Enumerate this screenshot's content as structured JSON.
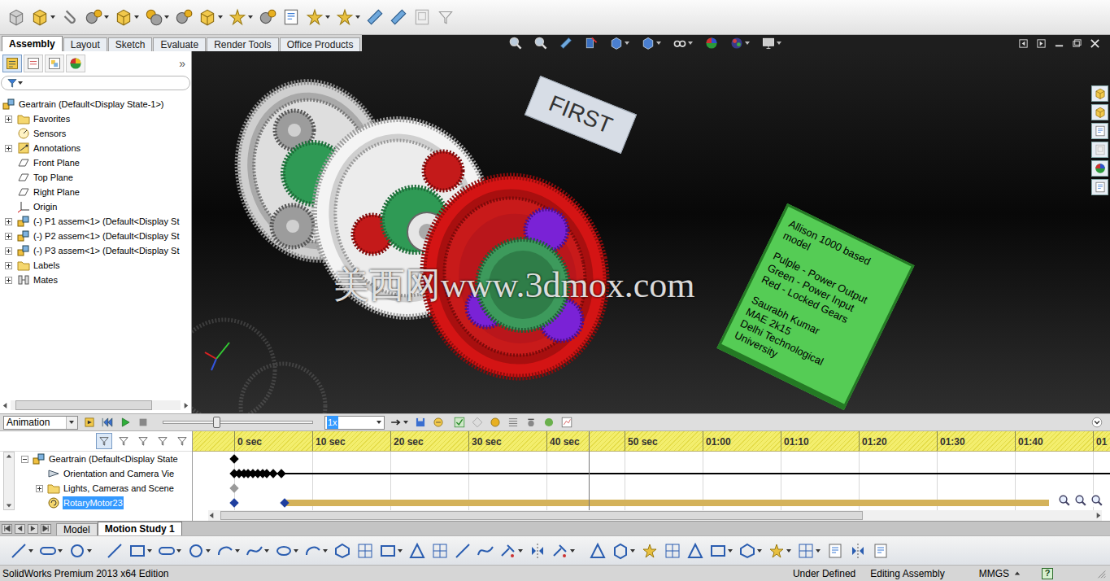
{
  "command_tabs": [
    {
      "label": "Assembly",
      "selected": true
    },
    {
      "label": "Layout",
      "selected": false
    },
    {
      "label": "Sketch",
      "selected": false
    },
    {
      "label": "Evaluate",
      "selected": false
    },
    {
      "label": "Render Tools",
      "selected": false
    },
    {
      "label": "Office Products",
      "selected": false
    }
  ],
  "feature_tree": {
    "collapse": "»",
    "panel_tabs": [
      {
        "selected": true
      },
      {
        "selected": false
      },
      {
        "selected": false
      },
      {
        "selected": false
      }
    ],
    "root": "Geartrain (Default<Display State-1>)",
    "items": [
      {
        "label": "Favorites",
        "kind": "folder",
        "expandable": true,
        "expanded": false
      },
      {
        "label": "Sensors",
        "kind": "sensor",
        "expandable": false,
        "expanded": false
      },
      {
        "label": "Annotations",
        "kind": "annotation",
        "expandable": true,
        "expanded": false
      },
      {
        "label": "Front Plane",
        "kind": "plane",
        "expandable": false,
        "expanded": false
      },
      {
        "label": "Top Plane",
        "kind": "plane",
        "expandable": false,
        "expanded": false
      },
      {
        "label": "Right Plane",
        "kind": "plane",
        "expandable": false,
        "expanded": false
      },
      {
        "label": "Origin",
        "kind": "origin",
        "expandable": false,
        "expanded": false
      },
      {
        "label": "(-) P1 assem<1> (Default<Display St",
        "kind": "assembly",
        "expandable": true,
        "expanded": false
      },
      {
        "label": "(-) P2 assem<1> (Default<Display St",
        "kind": "assembly",
        "expandable": true,
        "expanded": false
      },
      {
        "label": "(-) P3 assem<1> (Default<Display St",
        "kind": "assembly",
        "expandable": true,
        "expanded": false
      },
      {
        "label": "Labels",
        "kind": "folder",
        "expandable": true,
        "expanded": false
      },
      {
        "label": "Mates",
        "kind": "mates",
        "expandable": true,
        "expanded": false
      }
    ]
  },
  "viewport": {
    "tag": "FIRST",
    "note": [
      [
        "Allison 1000 based",
        "model"
      ],
      [
        "Pulple - Power Output",
        "Green - Power Input",
        "Red - Locked Gears"
      ],
      [
        "Saurabh Kumar",
        "MAE 2k15",
        "Delhi Technological",
        "University"
      ]
    ],
    "watermark": "美西网www.3dmox.com"
  },
  "motion": {
    "study_type": "Animation",
    "speed": "1x",
    "slider": {
      "level": 0.35
    },
    "playhead": {
      "level": 0.432
    },
    "ticks": [
      "0 sec",
      "10 sec",
      "20 sec",
      "30 sec",
      "40 sec",
      "50 sec",
      "01:00",
      "01:10",
      "01:20",
      "01:30",
      "01:40",
      "01"
    ],
    "rows": [
      {
        "label": "Geartrain (Default<Display State",
        "kind": "assembly",
        "depth": 0,
        "expandable": true,
        "expanded": true,
        "selected": false,
        "keys": [
          0
        ],
        "key_color": "#000000",
        "track": "none"
      },
      {
        "label": "Orientation and Camera Vie",
        "kind": "camera",
        "depth": 1,
        "expandable": false,
        "expanded": false,
        "selected": false,
        "keys": [
          0,
          0.6,
          1.2,
          1.8,
          2.4,
          3.0,
          3.6,
          4.2,
          5.0,
          6.0
        ],
        "key_color": "#000000",
        "track": "line"
      },
      {
        "label": "Lights, Cameras and Scene",
        "kind": "folder",
        "depth": 1,
        "expandable": true,
        "expanded": false,
        "selected": false,
        "keys": [
          0
        ],
        "key_color": "#9a9a9a",
        "track": "none"
      },
      {
        "label": "RotaryMotor23",
        "kind": "motor",
        "depth": 1,
        "expandable": false,
        "expanded": false,
        "selected": true,
        "keys": [
          0,
          6.5
        ],
        "key_color": "#1f3f9f",
        "track": "bar",
        "bar_end": 104.4,
        "bar_color": "#d4b25a"
      }
    ]
  },
  "model_tabs": [
    {
      "label": "Model",
      "selected": false
    },
    {
      "label": "Motion Study 1",
      "selected": true
    }
  ],
  "status_bar": {
    "product": "SolidWorks Premium 2013 x64 Edition",
    "state": "Under Defined",
    "mode": "Editing Assembly",
    "units": "MMGS",
    "help": "?"
  }
}
